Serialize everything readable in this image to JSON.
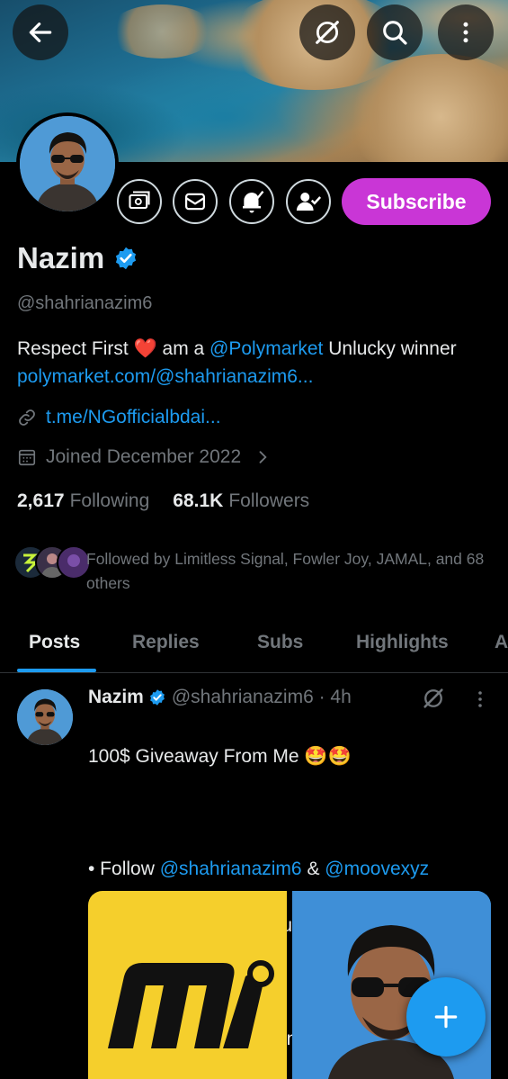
{
  "header": {
    "back_icon": "arrow-left-icon",
    "grok_icon": "grok-icon",
    "search_icon": "search-icon",
    "more_icon": "more-vertical-icon"
  },
  "profile": {
    "name": "Nazim",
    "handle": "@shahrianazim6",
    "bio_prefix": "Respect First ",
    "bio_heart": "❤️",
    "bio_mid": " am a ",
    "bio_mention": "@Polymarket",
    "bio_after": " Unlucky winner ",
    "bio_link": "polymarket.com/@shahrianazim6...",
    "website": "t.me/NGofficialbdai...",
    "joined": "Joined December 2022",
    "following_count": "2,617",
    "following_label": "Following",
    "followers_count": "68.1K",
    "followers_label": "Followers",
    "followed_by": "Followed by Limitless Signal, Fowler Joy, JAMAL, and 68 others",
    "subscribe_label": "Subscribe"
  },
  "tabs": [
    {
      "label": "Posts",
      "active": true
    },
    {
      "label": "Replies",
      "active": false
    },
    {
      "label": "Subs",
      "active": false
    },
    {
      "label": "Highlights",
      "active": false
    },
    {
      "label": "A",
      "active": false
    }
  ],
  "post": {
    "name": "Nazim",
    "handle_time": "@shahrianazim6 · 4h",
    "line1": "100$ Giveaway From Me 🤩🤩",
    "line2a": "• Follow ",
    "mention1": "@shahrianazim6",
    "line2b": " & ",
    "mention2": "@moovexyz",
    "line3": "• Like + RT ❤️ Drop Your Wallet",
    "line4": "Winner Announced Soon 🔥"
  },
  "colors": {
    "accent": "#1d9bf0",
    "subscribe": "#c936d6",
    "muted": "#71767b",
    "text": "#e7e9ea",
    "background": "#000000"
  }
}
